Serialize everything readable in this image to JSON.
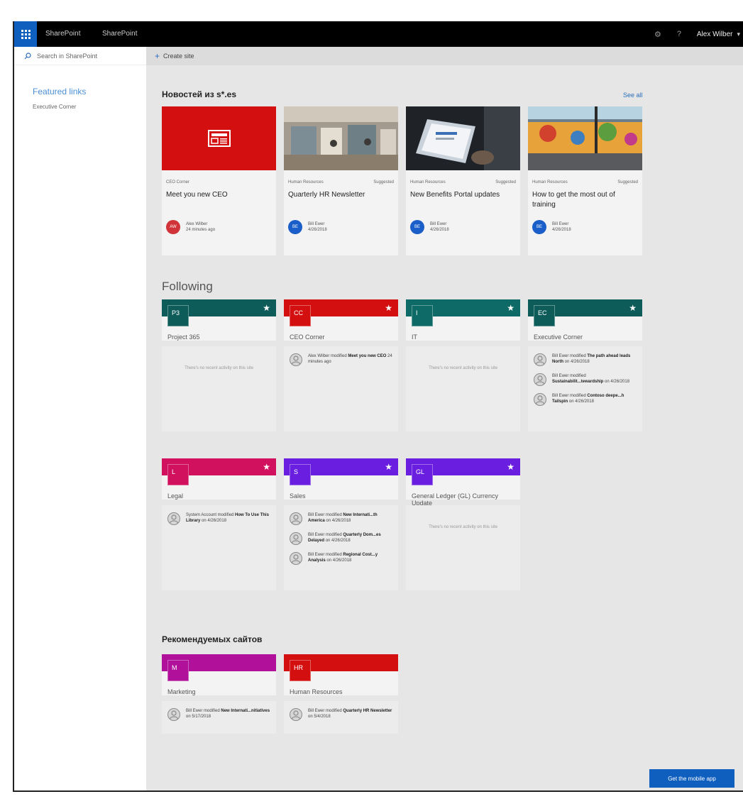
{
  "topbar": {
    "brand_primary": "SharePoint",
    "brand_secondary": "SharePoint",
    "user_name": "Alex Wilber"
  },
  "search": {
    "placeholder": "Search in SharePoint"
  },
  "leftnav": {
    "featured_title": "Featured links",
    "links": [
      "Executive Corner"
    ]
  },
  "commandbar": {
    "create_site_label": "Create site"
  },
  "news": {
    "title": "Новостей из s*.es",
    "see_all": "See all",
    "cards": [
      {
        "category": "CEO Corner",
        "tag": "",
        "title": "Meet you new CEO",
        "author": "Alex Wilber",
        "date": "24 minutes ago",
        "initials": "AW",
        "avatar_color": "#d13438",
        "image": "red-news-icon"
      },
      {
        "category": "Human Resources",
        "tag": "Suggested",
        "title": "Quarterly HR Newsletter",
        "author": "Bill Ewer",
        "date": "4/26/2018",
        "initials": "BE",
        "avatar_color": "#1a5fc9",
        "image": "office-photo"
      },
      {
        "category": "Human Resources",
        "tag": "Suggested",
        "title": "New Benefits Portal updates",
        "author": "Bill Ewer",
        "date": "4/26/2018",
        "initials": "BE",
        "avatar_color": "#1a5fc9",
        "image": "laptop-photo"
      },
      {
        "category": "Human Resources",
        "tag": "Suggested",
        "title": "How to get the most out of training",
        "author": "Bill Ewer",
        "date": "4/26/2018",
        "initials": "BE",
        "avatar_color": "#1a5fc9",
        "image": "mural-photo"
      }
    ]
  },
  "following": {
    "title": "Following",
    "sites": [
      {
        "abbr": "P3",
        "name": "Project 365",
        "color": "#0d5c5a",
        "no_activity": "There's no recent activity on this site",
        "activities": []
      },
      {
        "abbr": "CC",
        "name": "CEO Corner",
        "color": "#d30f0f",
        "no_activity": "",
        "activities": [
          {
            "who": "Alex Wilber modified",
            "what": "Meet you new CEO",
            "when": "24 minutes ago"
          }
        ]
      },
      {
        "abbr": "I",
        "name": "IT",
        "color": "#0d6a66",
        "no_activity": "There's no recent activity on this site",
        "activities": []
      },
      {
        "abbr": "EC",
        "name": "Executive Corner",
        "color": "#0d5c5a",
        "no_activity": "",
        "activities": [
          {
            "who": "Bill Ewer modified",
            "what": "The path ahead leads North",
            "when": "on 4/26/2018"
          },
          {
            "who": "Bill Ewer modified",
            "what": "Sustainabilit...tewardship",
            "when": "on 4/26/2018"
          },
          {
            "who": "Bill Ewer modified",
            "what": "Contoso deepe...h Tailspin",
            "when": "on 4/26/2018"
          }
        ]
      },
      {
        "abbr": "L",
        "name": "Legal",
        "color": "#d1105e",
        "no_activity": "",
        "activities": [
          {
            "who": "System Account modified",
            "what": "How To Use This Library",
            "when": "on 4/26/2018"
          }
        ]
      },
      {
        "abbr": "S",
        "name": "Sales",
        "color": "#6a1fe0",
        "no_activity": "",
        "activities": [
          {
            "who": "Bill Ewer modified",
            "what": "New Internati...th America",
            "when": "on 4/26/2018"
          },
          {
            "who": "Bill Ewer modified",
            "what": "Quarterly Dom...es Delayed",
            "when": "on 4/26/2018"
          },
          {
            "who": "Bill Ewer modified",
            "what": "Regional Cost...y Analysis",
            "when": "on 4/26/2018"
          }
        ]
      },
      {
        "abbr": "GL",
        "name": "General Ledger (GL) Currency Update",
        "color": "#6a1fe0",
        "no_activity": "There's no recent activity on this site",
        "activities": []
      }
    ]
  },
  "recommended": {
    "title": "Рекомендуемых сайтов",
    "sites": [
      {
        "abbr": "M",
        "name": "Marketing",
        "color": "#b0109a",
        "activities": [
          {
            "who": "Bill Ewer modified",
            "what": "New Internati...nitiatives",
            "when": "on 5/17/2018"
          }
        ]
      },
      {
        "abbr": "HR",
        "name": "Human Resources",
        "color": "#d30f0f",
        "activities": [
          {
            "who": "Bill Ewer modified",
            "what": "Quarterly HR Newsletter",
            "when": "on 5/4/2018"
          }
        ]
      }
    ]
  },
  "mobile_app": {
    "label": "Get the mobile app"
  },
  "icons": [
    "waffle-icon",
    "settings-icon",
    "help-icon",
    "search-icon",
    "plus-icon",
    "star-icon",
    "person-icon",
    "news-icon"
  ]
}
